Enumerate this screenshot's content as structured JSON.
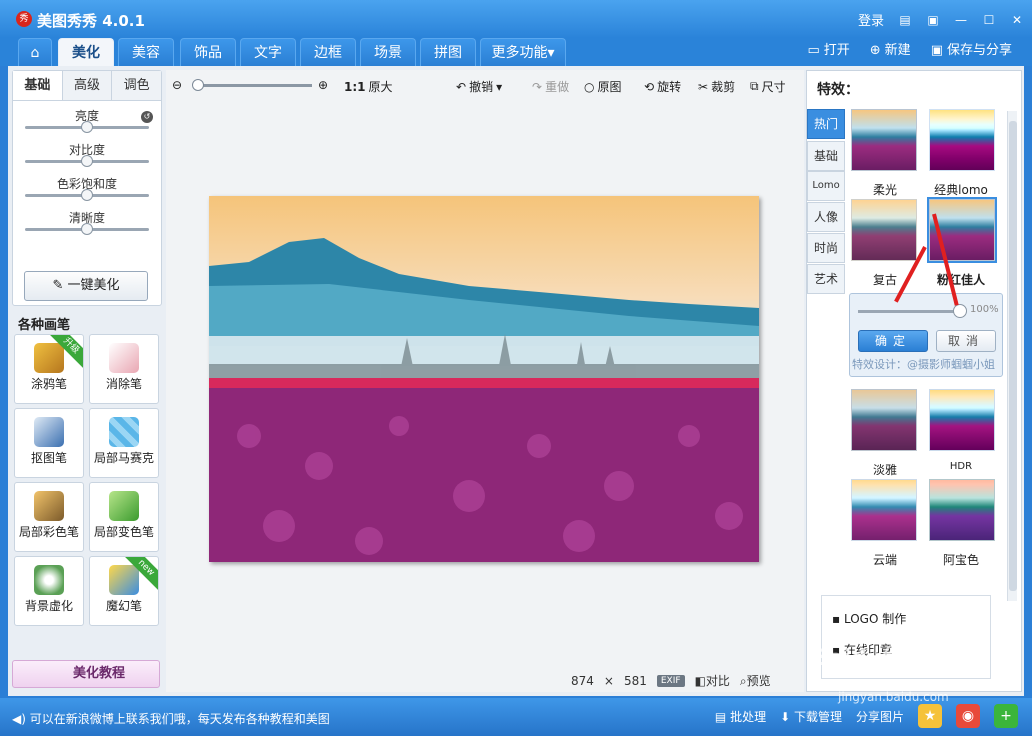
{
  "app": {
    "title": "美图秀秀 4.0.1",
    "logo_char": "秀"
  },
  "titlebar": {
    "login": "登录",
    "icons": [
      "chat-icon",
      "message-icon",
      "minimize-icon",
      "maximize-icon",
      "close-icon"
    ]
  },
  "tabs": [
    "美化",
    "美容",
    "饰品",
    "文字",
    "边框",
    "场景",
    "拼图",
    "更多功能"
  ],
  "toolbar_right": {
    "open": "打开",
    "new": "新建",
    "save": "保存与分享"
  },
  "left": {
    "subtabs": [
      "基础",
      "高级",
      "调色"
    ],
    "sliders": [
      {
        "label": "亮度",
        "value": 0.5
      },
      {
        "label": "对比度",
        "value": 0.5
      },
      {
        "label": "色彩饱和度",
        "value": 0.5
      },
      {
        "label": "清晰度",
        "value": 0.5
      }
    ],
    "onekey": "一键美化",
    "brush_title": "各种画笔",
    "brushes": [
      {
        "label": "涂鸦笔",
        "badge": "升级"
      },
      {
        "label": "消除笔",
        "badge": ""
      },
      {
        "label": "抠图笔",
        "badge": ""
      },
      {
        "label": "局部马赛克",
        "badge": ""
      },
      {
        "label": "局部彩色笔",
        "badge": ""
      },
      {
        "label": "局部变色笔",
        "badge": ""
      },
      {
        "label": "背景虚化",
        "badge": ""
      },
      {
        "label": "魔幻笔",
        "badge": "new"
      }
    ],
    "tutorial": "美化教程"
  },
  "canvas": {
    "zoom": {
      "actual": "1:1",
      "label": "原大",
      "value": 0.02
    },
    "undo": "撤销",
    "redo": "重做",
    "original": "原图",
    "rotate": "旋转",
    "crop": "裁剪",
    "size": "尺寸",
    "image_size": {
      "w": "874",
      "sep": "×",
      "h": "581"
    },
    "exif": "EXIF",
    "compare": "对比",
    "preview": "预览"
  },
  "effects": {
    "title": "特效：",
    "categories": [
      "热门",
      "基础",
      "Lomo",
      "人像",
      "时尚",
      "艺术"
    ],
    "items_top": [
      "柔光",
      "经典lomo",
      "复古",
      "粉红佳人"
    ],
    "popup": {
      "value": "100%",
      "value_fraction": 1.0,
      "ok": "确定",
      "cancel": "取消",
      "designer": "特效设计：@摄影师蝈蝈小姐"
    },
    "items_bottom": [
      "淡雅",
      "HDR",
      "云端",
      "阿宝色"
    ],
    "ad": [
      "LOGO 制作",
      "在线印章"
    ]
  },
  "statusbar": {
    "message": "可以在新浪微博上联系我们哦，每天发布各种教程和美图",
    "batch": "批处理",
    "download": "下载管理",
    "share": "分享图片"
  },
  "watermark": {
    "brand": "Baidu经验",
    "url": "jingyan.baidu.com"
  },
  "colors": {
    "accent": "#2a83d9",
    "ok_button": "#3a8ee0",
    "arrow": "#e02020"
  }
}
